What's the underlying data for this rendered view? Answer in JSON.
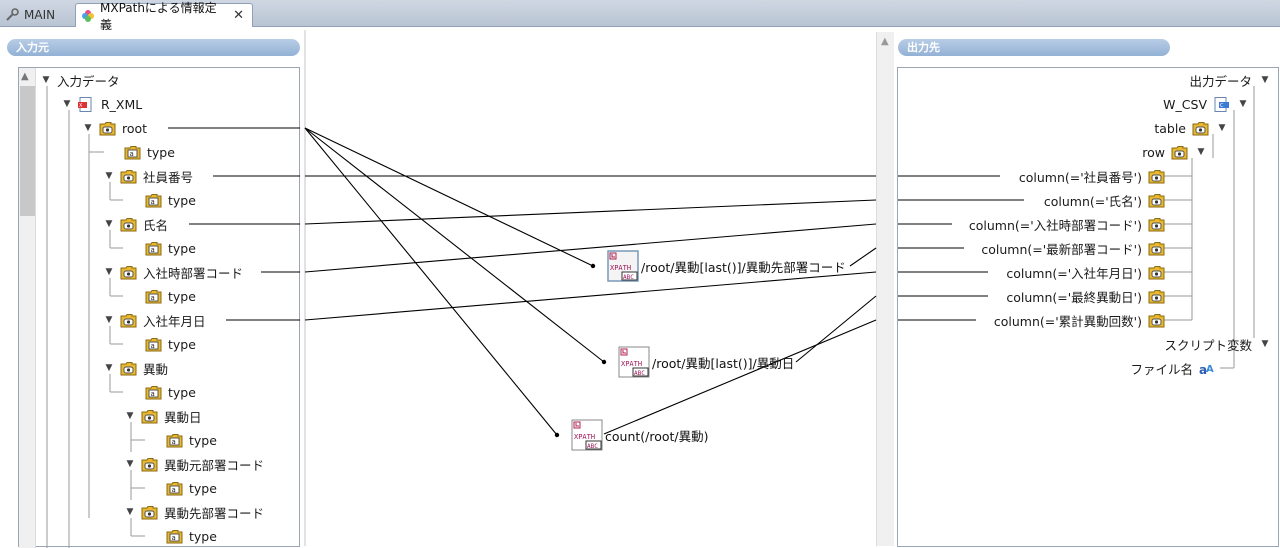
{
  "tabs": {
    "main": {
      "label": "MAIN"
    },
    "active": {
      "label": "MXPathによる情報定義",
      "close": "✕"
    }
  },
  "input_panel": {
    "title": "入力元",
    "root": "入力データ",
    "items": [
      {
        "label": "R_XML"
      },
      {
        "label": "root"
      },
      {
        "label": "type"
      },
      {
        "label": "社員番号"
      },
      {
        "label": "type"
      },
      {
        "label": "氏名"
      },
      {
        "label": "type"
      },
      {
        "label": "入社時部署コード"
      },
      {
        "label": "type"
      },
      {
        "label": "入社年月日"
      },
      {
        "label": "type"
      },
      {
        "label": "異動"
      },
      {
        "label": "type"
      },
      {
        "label": "異動日"
      },
      {
        "label": "type"
      },
      {
        "label": "異動元部署コード"
      },
      {
        "label": "type"
      },
      {
        "label": "異動先部署コード"
      },
      {
        "label": "type"
      }
    ]
  },
  "output_panel": {
    "title": "出力先",
    "root": "出力データ",
    "items": [
      {
        "label": "W_CSV"
      },
      {
        "label": "table"
      },
      {
        "label": "row"
      },
      {
        "label": "column(='社員番号')"
      },
      {
        "label": "column(='氏名')"
      },
      {
        "label": "column(='入社時部署コード')"
      },
      {
        "label": "column(='最新部署コード')"
      },
      {
        "label": "column(='入社年月日')"
      },
      {
        "label": "column(='最終異動日')"
      },
      {
        "label": "column(='累計異動回数')"
      }
    ],
    "script_vars": "スクリプト変数",
    "file_name": "ファイル名"
  },
  "functions": [
    {
      "label": "/root/異動[last()]/異動先部署コード"
    },
    {
      "label": "/root/異動[last()]/異動日"
    },
    {
      "label": "count(/root/異動)"
    }
  ],
  "colors": {
    "header": "#93b1d5",
    "wire": "#000000",
    "folder": "#e8b830"
  }
}
